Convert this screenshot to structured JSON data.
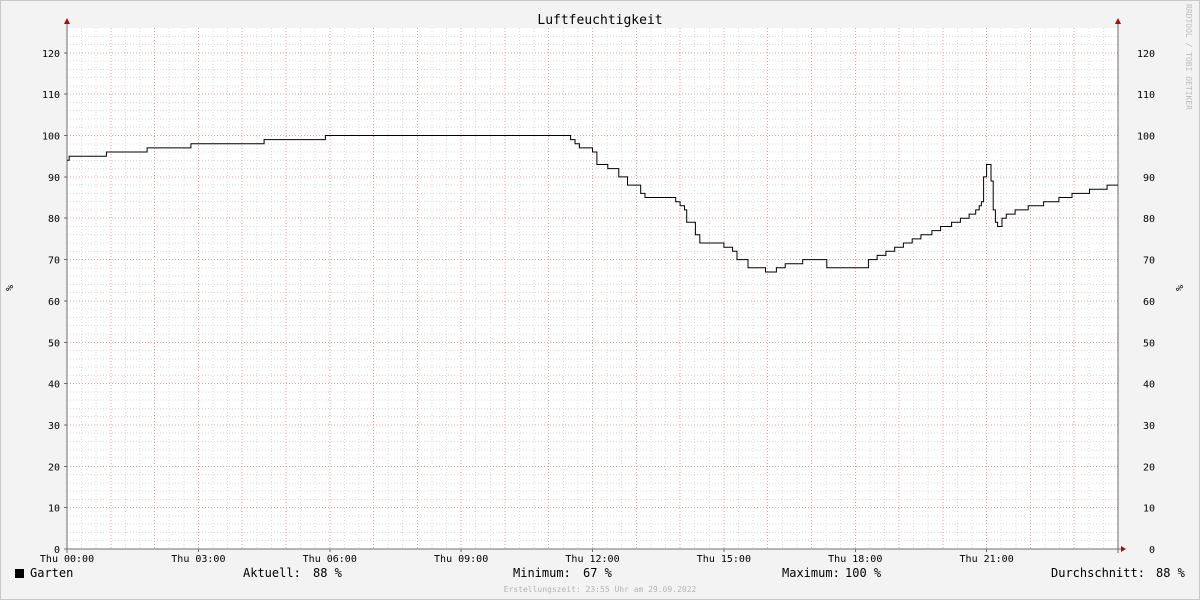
{
  "chart_data": {
    "type": "line",
    "title": "Luftfeuchtigkeit",
    "ylabel": "%",
    "ylabel_right": "%",
    "ylim": [
      0,
      126
    ],
    "xlim": [
      0,
      24
    ],
    "y_ticks": [
      0,
      10,
      20,
      30,
      40,
      50,
      60,
      70,
      80,
      90,
      100,
      110,
      120
    ],
    "x_ticks": [
      {
        "label": "Thu 00:00",
        "hour": 0
      },
      {
        "label": "Thu 03:00",
        "hour": 3
      },
      {
        "label": "Thu 06:00",
        "hour": 6
      },
      {
        "label": "Thu 09:00",
        "hour": 9
      },
      {
        "label": "Thu 12:00",
        "hour": 12
      },
      {
        "label": "Thu 15:00",
        "hour": 15
      },
      {
        "label": "Thu 18:00",
        "hour": 18
      },
      {
        "label": "Thu 21:00",
        "hour": 21
      }
    ],
    "grid": true,
    "series": [
      {
        "name": "Garten",
        "color": "#000000",
        "step": true,
        "x": [
          0,
          0.05,
          0.9,
          1.83,
          2.83,
          4.5,
          5.9,
          11.5,
          11.6,
          11.7,
          11.8,
          12.0,
          12.1,
          12.35,
          12.6,
          12.8,
          13.1,
          13.2,
          13.9,
          14.0,
          14.1,
          14.15,
          14.35,
          14.45,
          14.8,
          15.0,
          15.2,
          15.3,
          15.55,
          15.95,
          16.2,
          16.25,
          16.4,
          16.55,
          16.8,
          17.35,
          17.5,
          17.7,
          17.9,
          18.1,
          18.3,
          18.5,
          18.7,
          18.9,
          19.1,
          19.3,
          19.5,
          19.75,
          19.95,
          20.2,
          20.4,
          20.6,
          20.75,
          20.83,
          20.88,
          20.93,
          21.0,
          21.03,
          21.1,
          21.15,
          21.2,
          21.25,
          21.35,
          21.45,
          21.65,
          21.95,
          22.3,
          22.65,
          22.95,
          23.35,
          23.75,
          24.0
        ],
        "y": [
          94,
          95,
          96,
          97,
          98,
          99,
          100,
          99,
          98,
          97,
          97,
          96,
          93,
          92,
          90,
          88,
          86,
          85,
          84,
          83,
          82,
          79,
          76,
          74,
          74,
          73,
          72,
          70,
          68,
          67,
          68,
          68,
          69,
          69,
          70,
          68,
          68,
          68,
          68,
          68,
          70,
          71,
          72,
          73,
          74,
          75,
          76,
          77,
          78,
          79,
          80,
          81,
          82,
          83,
          84,
          90,
          93,
          93,
          89,
          82,
          79,
          78,
          80,
          81,
          82,
          83,
          84,
          85,
          86,
          87,
          88,
          88
        ]
      }
    ]
  },
  "legend": {
    "series_name": "Garten",
    "current_label": "Aktuell:",
    "current_value": "88 %",
    "min_label": "Minimum:",
    "min_value": "67 %",
    "max_label": "Maximum:",
    "max_value": "100 %",
    "avg_label": "Durchschnitt:",
    "avg_value": "88 %"
  },
  "footer": "Erstellungszeit: 23:55 Uhr am 29.09.2022",
  "watermark": "RRDTOOL / TOBI OETIKER",
  "colors": {
    "background": "#f3f3f3",
    "plot_area": "#ffffff",
    "minor_grid": "#dcdcdc",
    "major_grid": "#e8a0a0",
    "axis": "#6e6e6e",
    "arrow": "#a01010",
    "line": "#000000"
  }
}
